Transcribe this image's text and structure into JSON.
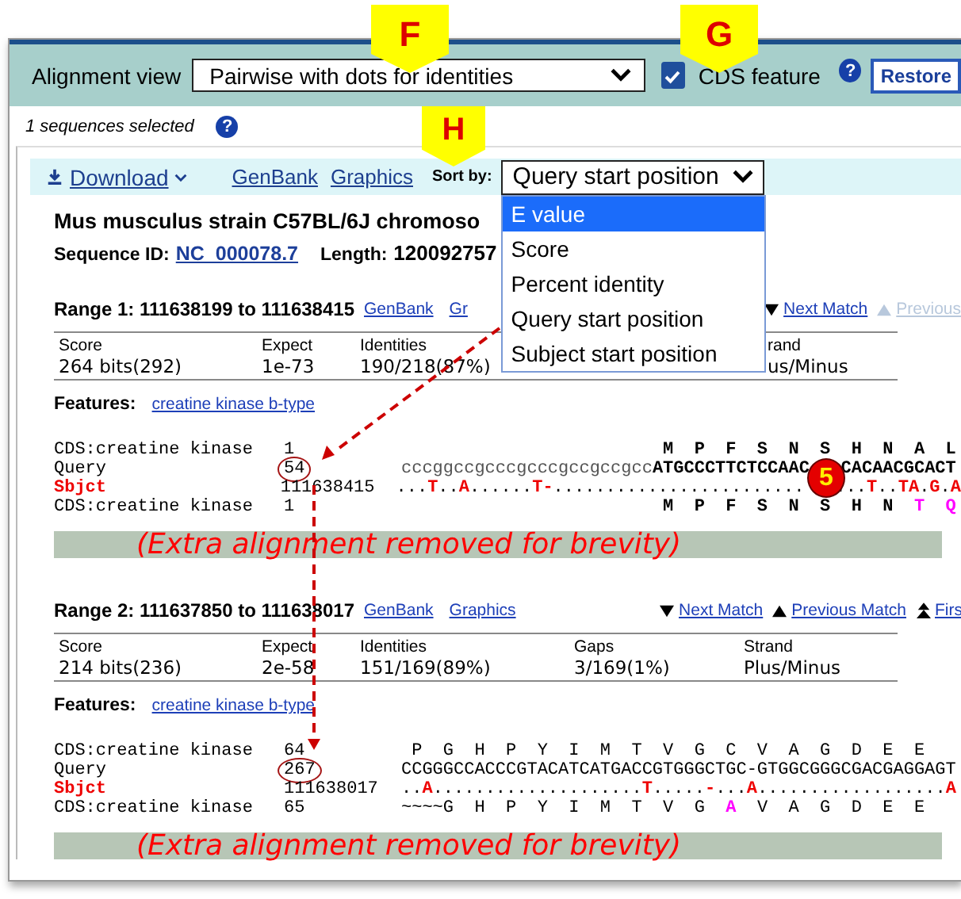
{
  "callouts": [
    {
      "letter": "F"
    },
    {
      "letter": "G"
    },
    {
      "letter": "H"
    }
  ],
  "alignment_view": {
    "label": "Alignment view",
    "value": "Pairwise with dots for identities"
  },
  "cds_feature": {
    "label": "CDS feature",
    "checked": true
  },
  "help_marks": [
    "?",
    "?"
  ],
  "restore_button": "Restore",
  "selection_note": "1 sequences selected",
  "toolbar": {
    "download": "Download",
    "links": [
      "GenBank",
      "Graphics"
    ],
    "sort_label": "Sort by:",
    "sort_value": "Query start position",
    "sort_options": [
      {
        "label": "E value",
        "selected": true
      },
      {
        "label": "Score",
        "selected": false
      },
      {
        "label": "Percent identity",
        "selected": false
      },
      {
        "label": "Query start position",
        "selected": false
      },
      {
        "label": "Subject start position",
        "selected": false
      }
    ]
  },
  "hit": {
    "title": "Mus musculus strain C57BL/6J chromoso",
    "sequence_id_label": "Sequence ID:",
    "sequence_id": "NC_000078.7",
    "length_label": "Length:",
    "length": "120092757"
  },
  "ranges": [
    {
      "heading": "Range 1: 111638199 to 111638415",
      "links": [
        "GenBank",
        "Gr"
      ],
      "nav": [
        {
          "kind": "next",
          "label": "Next Match",
          "disabled": false
        },
        {
          "kind": "previous",
          "label": "Previous",
          "disabled": true
        }
      ],
      "stats": [
        {
          "header": "Score",
          "value": "264 bits(292)",
          "clipped": false
        },
        {
          "header": "Expect",
          "value": "1e-73",
          "clipped": false
        },
        {
          "header": "Identities",
          "value": "190/218(87%)",
          "clipped": false
        },
        {
          "header": "rand",
          "value": "us/Minus",
          "clipped": true
        }
      ],
      "features_label": "Features:",
      "feature_link": "creatine kinase b-type",
      "badge": "5",
      "lines": [
        {
          "kind": "cds",
          "label": "CDS:creatine kinase",
          "start": "1",
          "circled": false,
          "segments": [
            {
              "text": "                         M  P  F  S  N  S  H  N  A  L",
              "kind": "normal"
            }
          ]
        },
        {
          "kind": "query",
          "label": "Query",
          "start": "54",
          "circled": true,
          "segments": [
            {
              "text": "cccggccgcccgcccgccgccgcc",
              "kind": "lower"
            },
            {
              "text": "ATGCCCTTCTCCAAC",
              "kind": "normal"
            },
            {
              "kind": "gap"
            },
            {
              "text": "CACAACGCACT",
              "kind": "normal"
            }
          ]
        },
        {
          "kind": "sbjct",
          "label": "Sbjct",
          "start": "111638415",
          "circled": false,
          "segments": [
            {
              "text": "...",
              "kind": "normal"
            },
            {
              "text": "T",
              "kind": "diff"
            },
            {
              "text": "..",
              "kind": "normal"
            },
            {
              "text": "A",
              "kind": "diff"
            },
            {
              "text": "......",
              "kind": "normal"
            },
            {
              "text": "T-",
              "kind": "diff"
            },
            {
              "text": "........................",
              "kind": "normal"
            },
            {
              "kind": "gap"
            },
            {
              "text": "...",
              "kind": "normal"
            },
            {
              "text": "T",
              "kind": "diff"
            },
            {
              "text": "..",
              "kind": "normal"
            },
            {
              "text": "TA",
              "kind": "diff"
            },
            {
              "text": ".",
              "kind": "normal"
            },
            {
              "text": "G",
              "kind": "diff"
            },
            {
              "text": ".",
              "kind": "normal"
            },
            {
              "text": "A",
              "kind": "diff"
            }
          ]
        },
        {
          "kind": "cds",
          "label": "CDS:creatine kinase",
          "start": "1",
          "circled": false,
          "segments": [
            {
              "text": "                         M  P  F  S  N  S  H  N  ",
              "kind": "normal"
            },
            {
              "text": "T  Q",
              "kind": "diff"
            }
          ]
        }
      ],
      "note": "(Extra alignment removed for brevity)"
    },
    {
      "heading": "Range 2: 111637850 to 111638017",
      "links": [
        "GenBank",
        "Graphics"
      ],
      "nav": [
        {
          "kind": "next",
          "label": "Next Match",
          "disabled": false
        },
        {
          "kind": "previous",
          "label": "Previous Match",
          "disabled": false
        },
        {
          "kind": "first",
          "label": "Firs",
          "disabled": false
        }
      ],
      "stats": [
        {
          "header": "Score",
          "value": "214 bits(236)",
          "clipped": false
        },
        {
          "header": "Expect",
          "value": "2e-58",
          "clipped": false
        },
        {
          "header": "Identities",
          "value": "151/169(89%)",
          "clipped": false
        },
        {
          "header": "Gaps",
          "value": "3/169(1%)",
          "clipped": false
        },
        {
          "header": "Strand",
          "value": "Plus/Minus",
          "clipped": false
        }
      ],
      "features_label": "Features:",
      "feature_link": "creatine kinase b-type",
      "lines": [
        {
          "kind": "cds",
          "label": "CDS:creatine kinase",
          "start": "64",
          "circled": false,
          "segments": [
            {
              "text": " P  G  H  P  Y  I  M  T  V  G  C  V  A  G  D  E  E",
              "kind": "normal"
            }
          ]
        },
        {
          "kind": "query",
          "label": "Query",
          "start": "267",
          "circled": true,
          "segments": [
            {
              "text": "CCGGGCCACCCGTACATCATGACCGTGGGCTGC-GTGGCGGGCGACGAGGAGT",
              "kind": "normal"
            }
          ]
        },
        {
          "kind": "sbjct",
          "label": "Sbjct",
          "start": "111638017",
          "circled": false,
          "segments": [
            {
              "text": "..",
              "kind": "normal"
            },
            {
              "text": "A",
              "kind": "diff"
            },
            {
              "text": "....................",
              "kind": "normal"
            },
            {
              "text": "T",
              "kind": "diff"
            },
            {
              "text": ".....",
              "kind": "normal"
            },
            {
              "text": "-",
              "kind": "diff"
            },
            {
              "text": "...",
              "kind": "normal"
            },
            {
              "text": "A",
              "kind": "diff"
            },
            {
              "text": "..................",
              "kind": "normal"
            },
            {
              "text": "A",
              "kind": "diff"
            }
          ]
        },
        {
          "kind": "cds",
          "label": "CDS:creatine kinase",
          "start": "65",
          "circled": false,
          "segments": [
            {
              "text": "~~~~G  H  P  Y  I  M  T  V  G  ",
              "kind": "normal"
            },
            {
              "text": "A",
              "kind": "diff"
            },
            {
              "text": "  V  A  G  D  E  E",
              "kind": "normal"
            }
          ]
        }
      ],
      "note": "(Extra alignment removed for brevity)"
    }
  ]
}
